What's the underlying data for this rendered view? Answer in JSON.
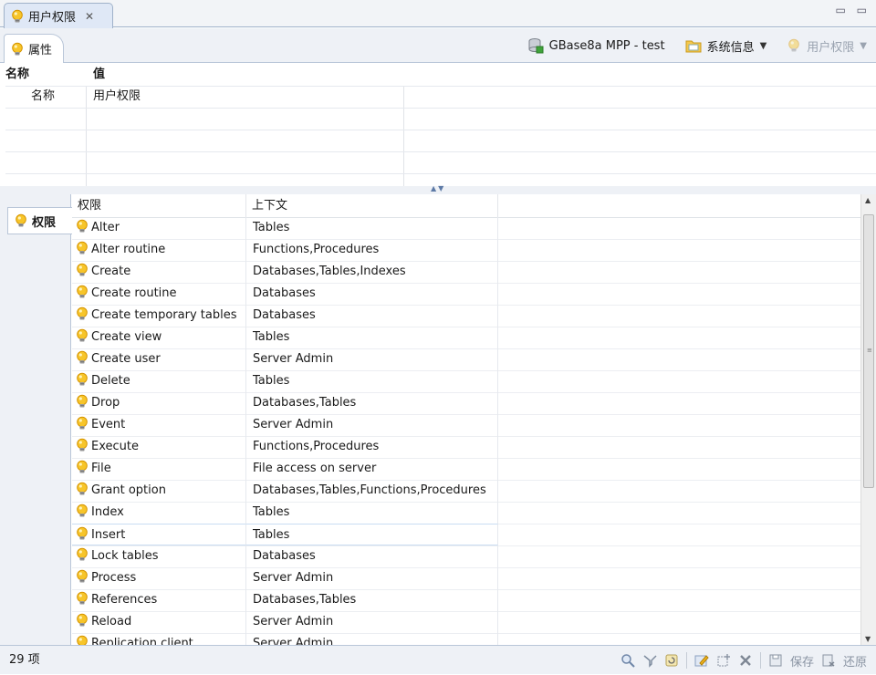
{
  "editor_tab": {
    "title": "用户权限",
    "close": "✕"
  },
  "window_controls": {
    "minimize": "▭",
    "maximize": "▭"
  },
  "properties_tab": {
    "label": "属性"
  },
  "toolbar": {
    "connection": "GBase8a MPP - test",
    "system_info": "系统信息",
    "user_privileges": "用户权限"
  },
  "properties": {
    "columns": [
      "名称",
      "值"
    ],
    "rows": [
      {
        "name": "名称",
        "value": "用户权限"
      }
    ]
  },
  "permissions_tab": {
    "label": "权限"
  },
  "permissions": {
    "columns": [
      "权限",
      "上下文"
    ],
    "rows": [
      {
        "name": "Alter",
        "context": "Tables"
      },
      {
        "name": "Alter routine",
        "context": "Functions,Procedures"
      },
      {
        "name": "Create",
        "context": "Databases,Tables,Indexes"
      },
      {
        "name": "Create routine",
        "context": "Databases"
      },
      {
        "name": "Create temporary tables",
        "context": "Databases"
      },
      {
        "name": "Create view",
        "context": "Tables"
      },
      {
        "name": "Create user",
        "context": "Server Admin"
      },
      {
        "name": "Delete",
        "context": "Tables"
      },
      {
        "name": "Drop",
        "context": "Databases,Tables"
      },
      {
        "name": "Event",
        "context": "Server Admin"
      },
      {
        "name": "Execute",
        "context": "Functions,Procedures"
      },
      {
        "name": "File",
        "context": "File access on server"
      },
      {
        "name": "Grant option",
        "context": "Databases,Tables,Functions,Procedures"
      },
      {
        "name": "Index",
        "context": "Tables"
      },
      {
        "name": "Insert",
        "context": "Tables"
      },
      {
        "name": "Lock tables",
        "context": "Databases"
      },
      {
        "name": "Process",
        "context": "Server Admin"
      },
      {
        "name": "References",
        "context": "Databases,Tables"
      },
      {
        "name": "Reload",
        "context": "Server Admin"
      },
      {
        "name": "Replication client",
        "context": "Server Admin"
      }
    ],
    "selected_index": 14
  },
  "status": {
    "count": "29 项",
    "save": "保存",
    "revert": "还原"
  },
  "colors": {
    "accent": "#f2b51b",
    "border": "#b9c6d8",
    "selected": "#c9dcf2"
  }
}
